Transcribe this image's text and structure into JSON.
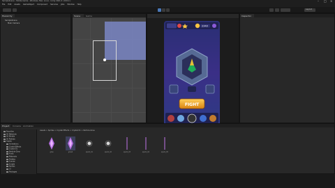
{
  "window": {
    "title": "SampleScene - Mobile Game - Windows, Mac, Linux - Unity 2021.3 <DX11>",
    "menu": [
      "File",
      "Edit",
      "Assets",
      "GameObject",
      "Component",
      "Services",
      "Jobs",
      "Window",
      "Help"
    ]
  },
  "toolbar": {
    "layout_label": "Layout"
  },
  "hierarchy": {
    "tab": "Hierarchy",
    "items": [
      "SampleScene",
      "Main Camera"
    ]
  },
  "scene_tabs": [
    "Scene",
    "Game"
  ],
  "game_view": {
    "top_bar": {
      "coins": "2343",
      "stars": "3"
    },
    "fight_button": "FIGHT",
    "bottom_icons": [
      "hero-a-icon",
      "hero-b-icon",
      "skull-icon",
      "shield-icon",
      "chest-icon"
    ]
  },
  "inspector": {
    "tab": "Inspector"
  },
  "project": {
    "tabs": [
      "Project",
      "Console",
      "Animation"
    ],
    "breadcrumb": "Assets > Sprites > Crystal Effects > Crystal 01 > Particle Glow",
    "tree": [
      "Favorites",
      "All Materials",
      "All Models",
      "All Prefabs",
      "Assets",
      "Animations",
      "Crystal Effects",
      "Crystal 01",
      "Particle Glow",
      "Fonts",
      "Materials",
      "Prefabs",
      "Scenes",
      "Scripts",
      "Sprites",
      "UI",
      "Packages"
    ],
    "assets": [
      {
        "name": "glow",
        "kind": "crystal"
      },
      {
        "name": "glow2",
        "kind": "crystal-selected"
      },
      {
        "name": "spark_01",
        "kind": "dot"
      },
      {
        "name": "spark_02",
        "kind": "dot"
      },
      {
        "name": "spark_03",
        "kind": "line"
      },
      {
        "name": "spark_04",
        "kind": "line"
      },
      {
        "name": "spark_05",
        "kind": "line"
      }
    ]
  },
  "colors": {
    "accent": "#4a78b8",
    "scene_selection": "#7a86c4",
    "fight": "#e9a21c",
    "panel": "#282828",
    "background": "#191919"
  }
}
